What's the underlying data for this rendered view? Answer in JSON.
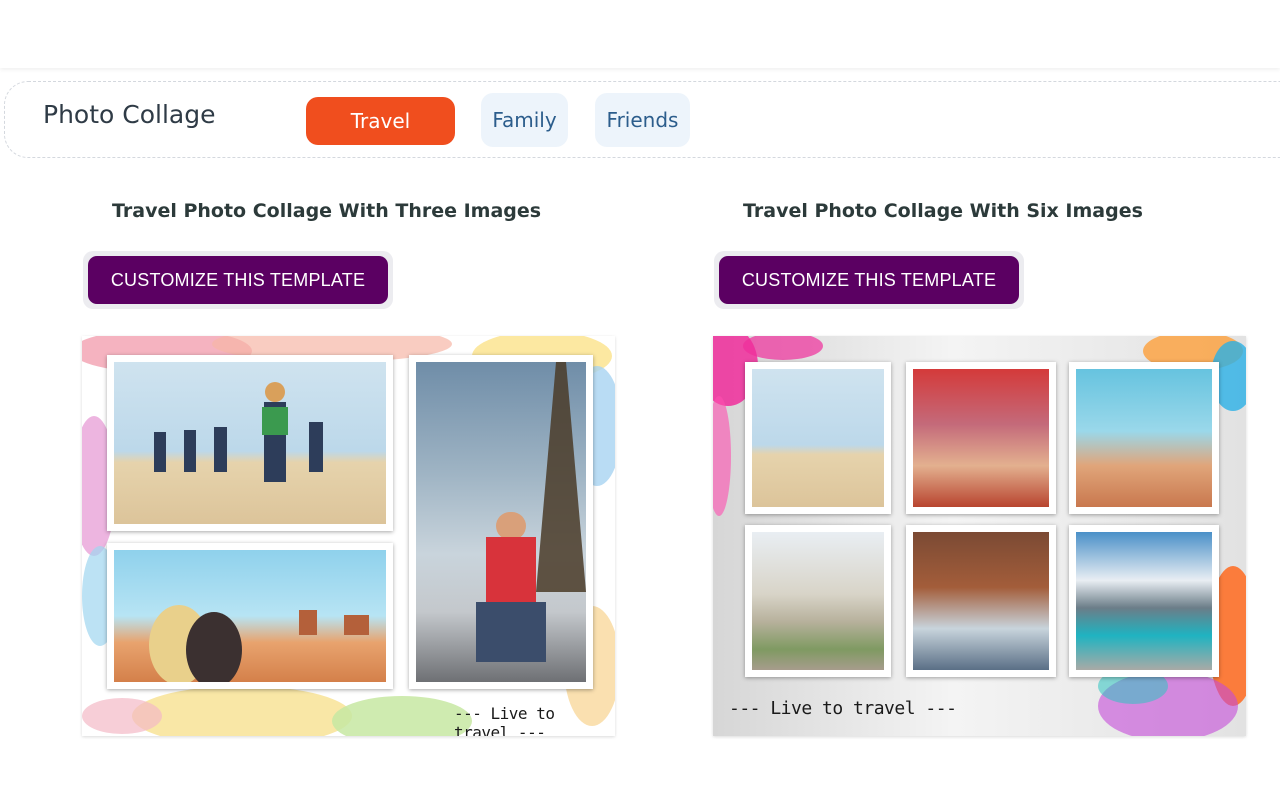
{
  "tabbar": {
    "title": "Photo Collage",
    "tabs": [
      {
        "label": "Travel",
        "active": true
      },
      {
        "label": "Family",
        "active": false
      },
      {
        "label": "Friends",
        "active": false
      }
    ]
  },
  "colors": {
    "accent": "#f04e1e",
    "cta": "#5b0062",
    "tab_bg": "#edf4fb",
    "tab_text": "#2c5d8c"
  },
  "cards": [
    {
      "title": "Travel Photo Collage With Three Images",
      "cta_label": "CUSTOMIZE THIS TEMPLATE",
      "tagline": "--- Live to travel ---"
    },
    {
      "title": "Travel Photo Collage With Six Images",
      "cta_label": "CUSTOMIZE THIS TEMPLATE",
      "tagline": "--- Live to travel ---"
    }
  ]
}
